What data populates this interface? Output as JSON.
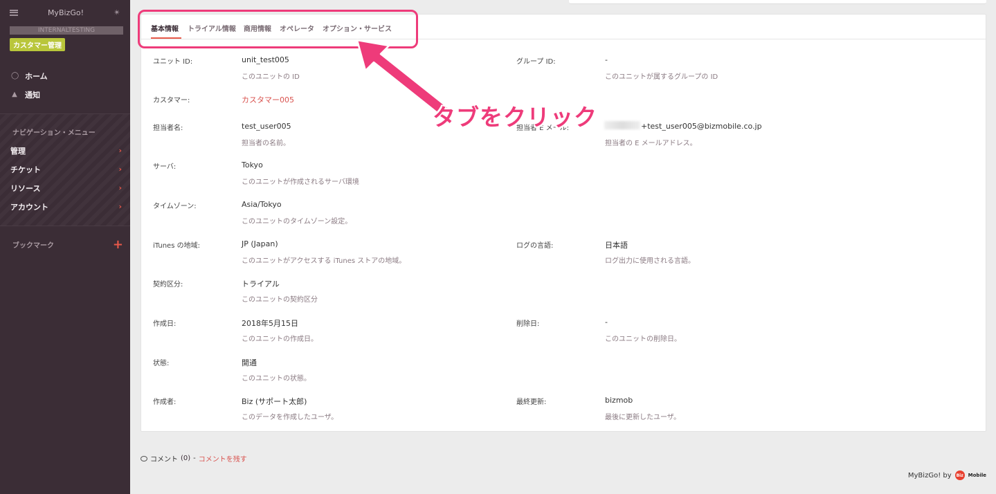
{
  "sidebar": {
    "app_name": "MyBizGo!",
    "tenant": "INTERNALTESTING",
    "badge": "カスタマー管理",
    "links": [
      {
        "label": "ホーム",
        "icon": "home-circle-icon"
      },
      {
        "label": "通知",
        "icon": "bell-icon"
      }
    ],
    "nav_heading": "ナビゲーション・メニュー",
    "nav_items": [
      {
        "label": "管理"
      },
      {
        "label": "チケット"
      },
      {
        "label": "リソース"
      },
      {
        "label": "アカウント"
      }
    ],
    "bookmark_label": "ブックマーク",
    "bookmark_add": "+"
  },
  "tabs": [
    {
      "label": "基本情報",
      "active": true
    },
    {
      "label": "トライアル情報"
    },
    {
      "label": "商用情報"
    },
    {
      "label": "オペレータ"
    },
    {
      "label": "オプション・サービス"
    }
  ],
  "fields": {
    "unit_id": {
      "label": "ユニット ID:",
      "value": "unit_test005",
      "desc": "このユニットの ID"
    },
    "group_id": {
      "label": "グループ ID:",
      "value": "-",
      "desc": "このユニットが属するグループの ID"
    },
    "customer": {
      "label": "カスタマー:",
      "value": "カスタマー005"
    },
    "person": {
      "label": "担当者名:",
      "value": "test_user005",
      "desc": "担当者の名前。"
    },
    "email": {
      "label": "担当者 E メール:",
      "value": "+test_user005@bizmobile.co.jp",
      "desc": "担当者の E メールアドレス。"
    },
    "server": {
      "label": "サーバ:",
      "value": "Tokyo",
      "desc": "このユニットが作成されるサーバ環境"
    },
    "timezone": {
      "label": "タイムゾーン:",
      "value": "Asia/Tokyo",
      "desc": "このユニットのタイムゾーン設定。"
    },
    "itunes": {
      "label": "iTunes の地域:",
      "value": "JP (Japan)",
      "desc": "このユニットがアクセスする iTunes ストアの地域。"
    },
    "log_lang": {
      "label": "ログの言語:",
      "value": "日本語",
      "desc": "ログ出力に使用される言語。"
    },
    "contract": {
      "label": "契約区分:",
      "value": "トライアル",
      "desc": "このユニットの契約区分"
    },
    "created": {
      "label": "作成日:",
      "value": "2018年5月15日",
      "desc": "このユニットの作成日。"
    },
    "deleted": {
      "label": "削除日:",
      "value": "-",
      "desc": "このユニットの削除日。"
    },
    "status": {
      "label": "状態:",
      "value": "開通",
      "desc": "このユニットの状態。"
    },
    "creator": {
      "label": "作成者:",
      "value": "Biz (サポート太郎)",
      "desc": "このデータを作成したユーザ。"
    },
    "updated": {
      "label": "最終更新:",
      "value": "bizmob",
      "desc": "最後に更新したユーザ。"
    }
  },
  "comments": {
    "label": "コメント",
    "count": "(0)",
    "sep": "-",
    "add": "コメントを残す"
  },
  "footer": {
    "text": "MyBizGo! by",
    "logo_mark": "Biz",
    "logo_text": "Mobile"
  },
  "annotation": {
    "text": "タブをクリック",
    "color": "#ee3b7a"
  },
  "colors": {
    "sidebar": "#3b2d36",
    "accent": "#e8594a",
    "badge": "#b9c63b",
    "link": "#d9534f"
  }
}
